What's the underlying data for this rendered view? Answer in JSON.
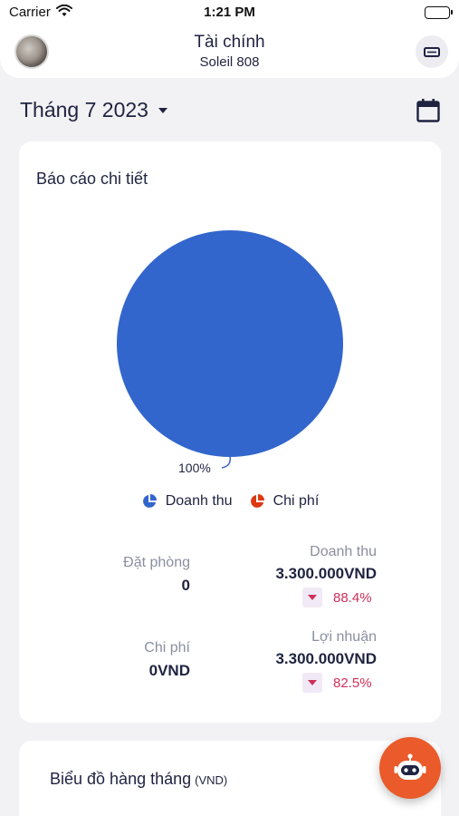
{
  "status_bar": {
    "carrier": "Carrier",
    "time": "1:21 PM"
  },
  "header": {
    "title": "Tài chính",
    "subtitle": "Soleil 808"
  },
  "month_selector": {
    "label": "Tháng 7 2023"
  },
  "report": {
    "title": "Báo cáo chi tiết",
    "pie_label": "100%",
    "legend": [
      {
        "label": "Doanh thu",
        "color": "#3366cc"
      },
      {
        "label": "Chi phí",
        "color": "#dc3912"
      }
    ],
    "bookings": {
      "label": "Đặt phòng",
      "value": "0"
    },
    "revenue": {
      "label": "Doanh thu",
      "value": "3.300.000VND",
      "change": "88.4%"
    },
    "expenses": {
      "label": "Chi phí",
      "value": "0VND"
    },
    "profit": {
      "label": "Lợi nhuận",
      "value": "3.300.000VND",
      "change": "82.5%"
    }
  },
  "monthly_chart": {
    "title": "Biểu đồ hàng tháng",
    "unit": "(VND)"
  },
  "chart_data": {
    "type": "pie",
    "categories": [
      "Doanh thu",
      "Chi phí"
    ],
    "values": [
      100,
      0
    ],
    "colors": [
      "#3366cc",
      "#dc3912"
    ]
  },
  "colors": {
    "accent": "#ea5a2a",
    "pie_blue": "#3366cc",
    "negative": "#d02f5a"
  }
}
